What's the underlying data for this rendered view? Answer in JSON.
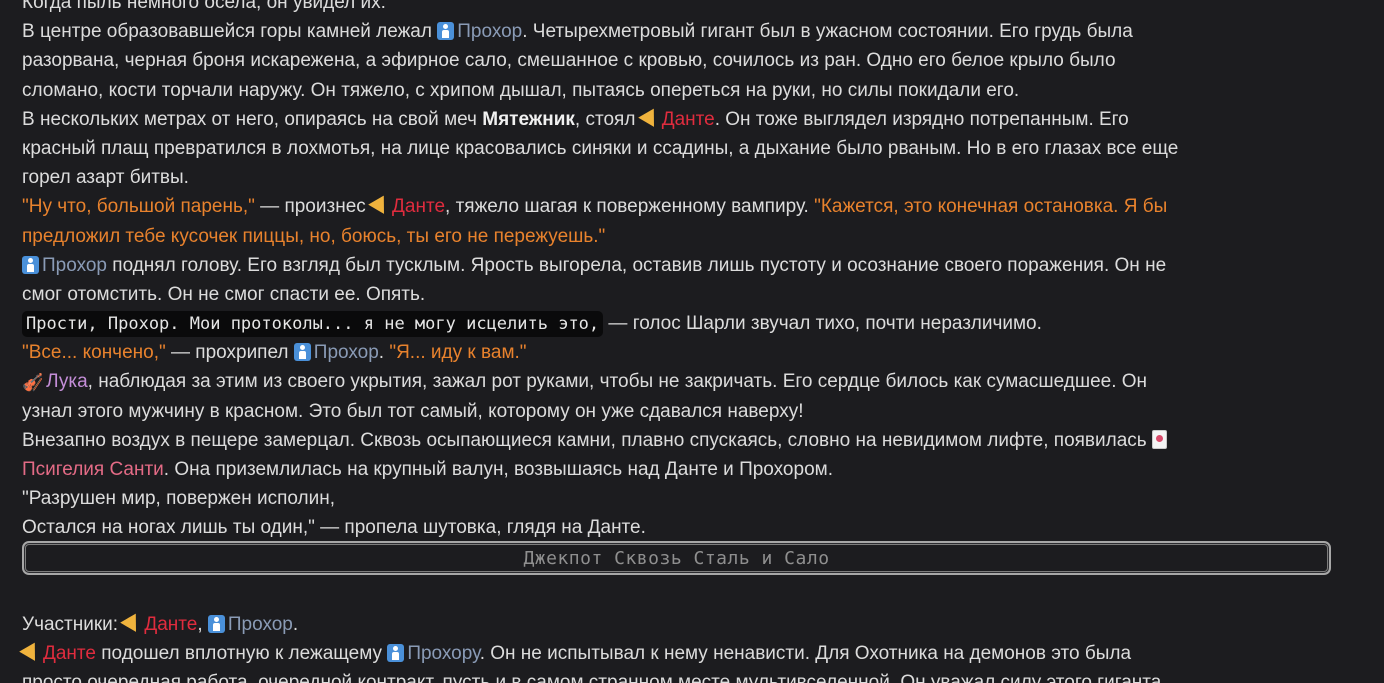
{
  "story": {
    "l0": "Когда пыль немного осела, он увидел их:",
    "p1": {
      "a": "В центре образовавшейся горы камней лежал ",
      "prohor": "Прохор",
      "b": ". Четырехметровый гигант был в ужасном состоянии. Его грудь была",
      "c": "разорвана, черная броня искарежена, а эфирное сало, смешанное с кровью, сочилось из ран. Одно его белое крыло было",
      "d": "сломано, кости торчали наружу. Он тяжело, с хрипом дышал, пытаясь опереться на руки, но силы покидали его."
    },
    "p2": {
      "a": "В нескольких метрах от него, опираясь на свой меч ",
      "sword": "Мятежник",
      "b": ", стоял ",
      "dante": "Данте",
      "c": ". Он тоже выглядел изрядно потрепанным. Его",
      "d": "красный плащ превратился в лохмотья, на лице красовались синяки и ссадины, а дыхание было рваным. Но в его глазах все еще",
      "e": "горел азарт битвы."
    },
    "p3": {
      "q1": "\"Ну что, большой парень,\"",
      "a": " — произнес ",
      "dante": "Данте",
      "b": ", тяжело шагая к поверженному вампиру. ",
      "q2a": "\"Кажется, это конечная остановка. Я бы",
      "q2b": "предложил тебе кусочек пиццы, но, боюсь, ты его не пережуешь.\""
    },
    "p4": {
      "prohor": "Прохор",
      "a": " поднял голову. Его взгляд был тусклым. Ярость выгорела, оставив лишь пустоту и осознание своего поражения. Он не",
      "b": "смог отомстить. Он не смог спасти ее. Опять."
    },
    "p5": {
      "code": "Прости, Прохор. Мои протоколы... я не могу исцелить это,",
      "a": " — голос Шарли звучал тихо, почти неразличимо."
    },
    "p6": {
      "q1": "\"Все... кончено,\"",
      "a": " — прохрипел ",
      "prohor": "Прохор",
      "b": ". ",
      "q2": "\"Я... иду к вам.\""
    },
    "p7": {
      "luka": "Лука",
      "a": ", наблюдая за этим из своего укрытия, зажал рот руками, чтобы не закричать. Его сердце билось как сумасшедшее. Он",
      "b": "узнал этого мужчину в красном. Это был тот самый, которому он уже сдавался наверху!"
    },
    "p8": {
      "a": "Внезапно воздух в пещере замерцал. Сквозь осыпающиеся камни, плавно спускаясь, словно на невидимом лифте, появилась",
      "psy": "Псигелия Санти",
      "b": ". Она приземлилась на крупный валун, возвышаясь над Данте и Прохором."
    },
    "p9": {
      "a": "\"Разрушен мир, повержен исполин,",
      "b": "Остался на ногах лишь ты один,\" — пропела шутовка, глядя на Данте."
    }
  },
  "chapter_title": "Джекпот Сквозь Сталь и Сало",
  "next": {
    "participants_label": "Участники: ",
    "dante": "Данте",
    "comma": ", ",
    "prohor": "Прохор",
    "dot": ".",
    "dante2": "Данте",
    "l2a": " подошел вплотную к лежащему ",
    "prohoru": "Прохору",
    "l2b": ". Он не испытывал к нему ненависти. Для Охотника на демонов это была",
    "l3": "просто очередная работа, очередной контракт, пусть и в самом странном месте мультивселенной. Он уважал силу этого гиганта,"
  },
  "icons": {
    "prohor": "man-icon",
    "dante": "pizza-icon",
    "luka": "violin-icon",
    "psy": "playing-card-icon"
  },
  "colors": {
    "background": "#1c1c1f",
    "text": "#dcdcdc",
    "prohor": "#8a9bb6",
    "dante": "#e02c3e",
    "quote": "#e8822d",
    "psy": "#e46b86",
    "luka": "#c48ed8"
  }
}
